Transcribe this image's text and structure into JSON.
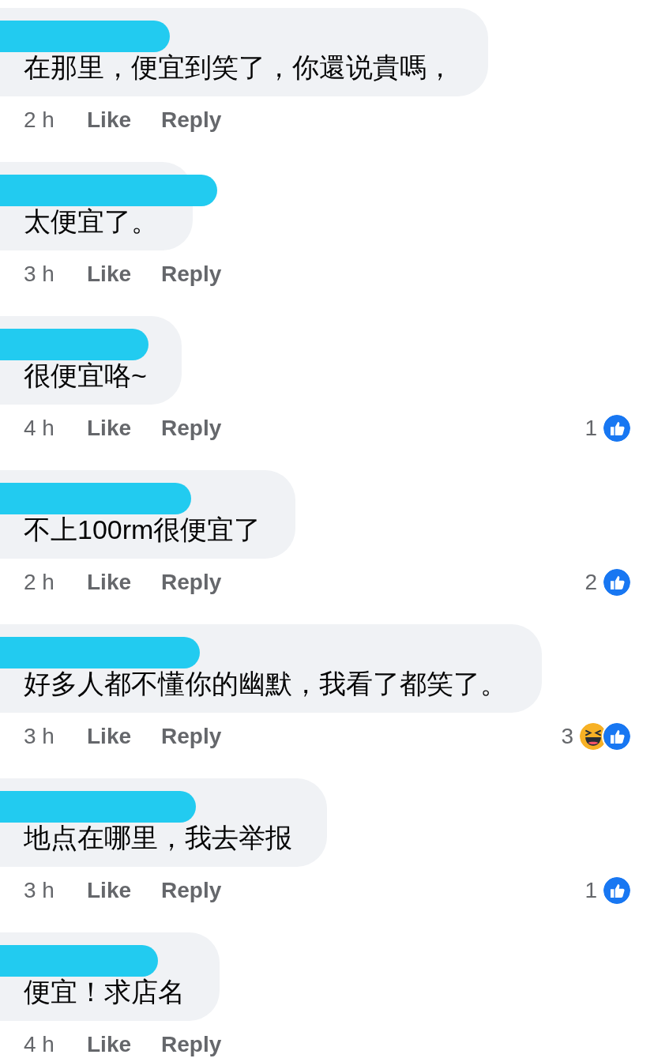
{
  "comments": [
    {
      "text": "在那里，便宜到笑了，你還说貴嗎，",
      "time": "2 h",
      "actions": [
        "Like",
        "Reply"
      ]
    },
    {
      "text": "太便宜了。",
      "time": "3 h",
      "actions": [
        "Like",
        "Reply"
      ]
    },
    {
      "text": "很便宜咯~",
      "time": "4 h",
      "actions": [
        "Like",
        "Reply"
      ],
      "reactions": {
        "count": "1",
        "icons": [
          {
            "kind": "like"
          }
        ]
      }
    },
    {
      "text": "不上100rm很便宜了",
      "time": "2 h",
      "actions": [
        "Like",
        "Reply"
      ],
      "reactions": {
        "count": "2",
        "icons": [
          {
            "kind": "like"
          }
        ]
      }
    },
    {
      "text": "好多人都不懂你的幽默，我看了都笑了。",
      "time": "3 h",
      "actions": [
        "Like",
        "Reply"
      ],
      "reactions": {
        "count": "3",
        "icons": [
          {
            "kind": "haha"
          },
          {
            "kind": "like"
          }
        ]
      }
    },
    {
      "text": "地点在哪里，我去举报",
      "time": "3 h",
      "actions": [
        "Like",
        "Reply"
      ],
      "reactions": {
        "count": "1",
        "icons": [
          {
            "kind": "like"
          }
        ]
      }
    },
    {
      "text": "便宜！求店名",
      "time": "4 h",
      "actions": [
        "Like",
        "Reply"
      ]
    }
  ]
}
